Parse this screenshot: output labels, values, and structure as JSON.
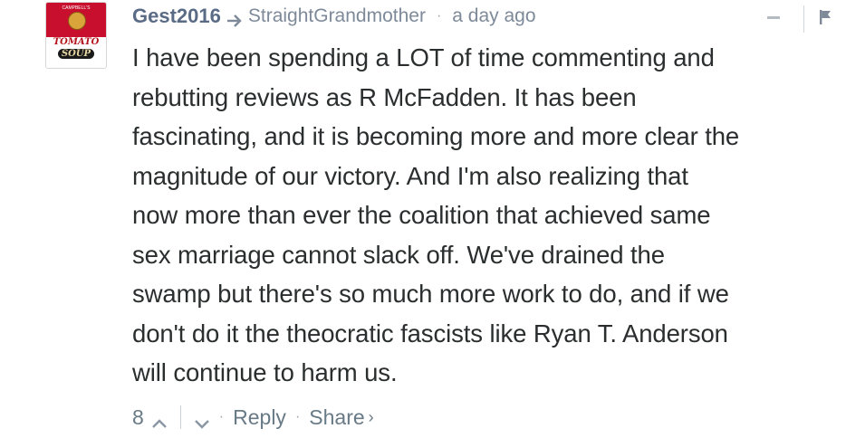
{
  "comment": {
    "author": "Gest2016",
    "parent_author": "StraightGrandmother",
    "timestamp": "a day ago",
    "avatar": {
      "icon": "tomato-soup-can-icon",
      "label_line1": "TOMATO",
      "label_line2": "SOUP",
      "small_text": "CAMPBELL'S"
    },
    "body_lines": [
      "I have been spending a LOT of time commenting and",
      "rebutting reviews as R McFadden. It has been",
      "fascinating, and it is becoming more and more clear the",
      "magnitude of our victory. And I'm also realizing that",
      "now more than ever the coalition that achieved same",
      "sex marriage cannot slack off. We've drained the",
      "swamp but there's so much more work to do, and if we",
      "don't do it the theocratic fascists like Ryan T. Anderson",
      "will continue to harm us."
    ],
    "footer": {
      "upvote_count": "8",
      "reply_label": "Reply",
      "share_label": "Share",
      "share_caret": "›",
      "separator": "·"
    },
    "icons": {
      "reply_arrow": "reply-arrow-icon",
      "collapse": "minus-icon",
      "flag": "flag-icon",
      "upvote": "chevron-up-icon",
      "downvote": "chevron-down-icon"
    }
  },
  "colors": {
    "author": "#5a6b86",
    "meta": "#7e8a99",
    "body": "#2a2e2e",
    "footer": "#687a86"
  }
}
